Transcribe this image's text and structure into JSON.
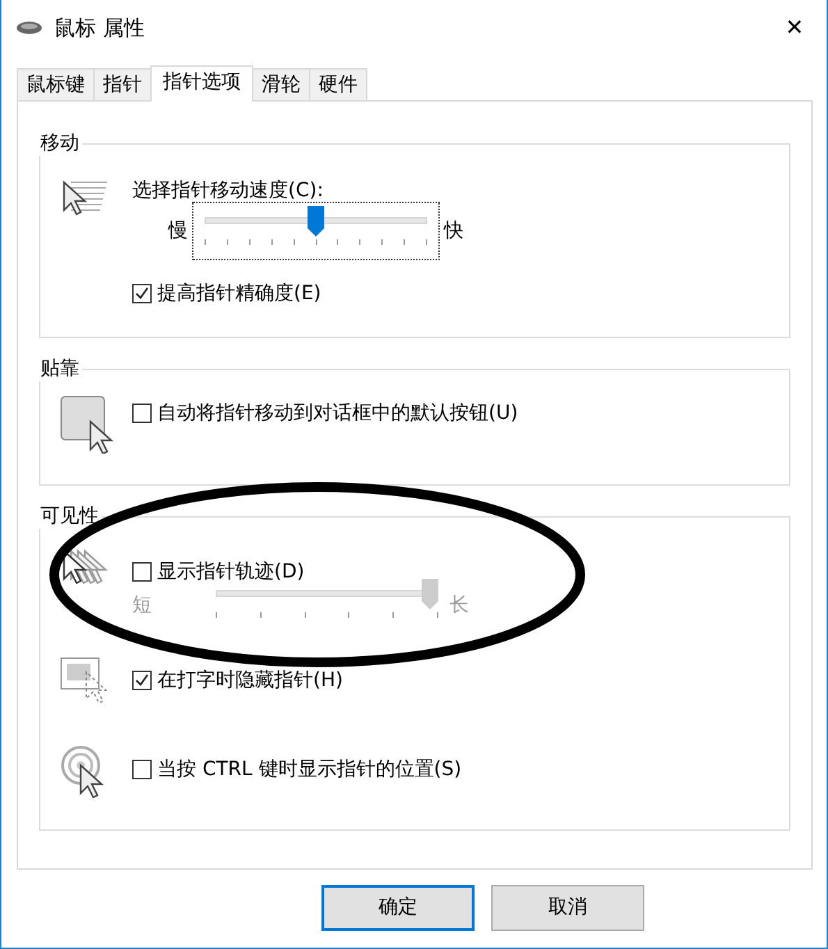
{
  "window": {
    "title": "鼠标 属性",
    "close": "✕"
  },
  "tabs": [
    {
      "label": "鼠标键",
      "selected": false
    },
    {
      "label": "指针",
      "selected": false
    },
    {
      "label": "指针选项",
      "selected": true
    },
    {
      "label": "滑轮",
      "selected": false
    },
    {
      "label": "硬件",
      "selected": false
    }
  ],
  "groups": [
    {
      "title": "移动",
      "sections": [
        {
          "kind": "speed",
          "items": [
            {
              "kind": "label",
              "text": "选择指针移动速度(C):"
            },
            {
              "kind": "slider",
              "min_label": "慢",
              "max_label": "快",
              "level": 0.5,
              "disabled": false,
              "focused": true
            },
            {
              "kind": "checkbox",
              "label": "提高指针精确度(E)",
              "checked": true
            }
          ]
        }
      ]
    },
    {
      "title": "贴靠",
      "sections": [
        {
          "kind": "snap",
          "items": [
            {
              "kind": "checkbox",
              "label": "自动将指针移动到对话框中的默认按钮(U)",
              "checked": false
            }
          ]
        }
      ]
    },
    {
      "title": "可见性",
      "sections": [
        {
          "kind": "trails",
          "items": [
            {
              "kind": "checkbox",
              "label": "显示指针轨迹(D)",
              "checked": false
            },
            {
              "kind": "slider",
              "min_label": "短",
              "max_label": "长",
              "level": 1.0,
              "disabled": true,
              "focused": false
            }
          ]
        },
        {
          "kind": "hide",
          "items": [
            {
              "kind": "checkbox",
              "label": "在打字时隐藏指针(H)",
              "checked": true
            }
          ]
        },
        {
          "kind": "locate",
          "items": [
            {
              "kind": "checkbox",
              "label": "当按 CTRL 键时显示指针的位置(S)",
              "checked": false
            }
          ]
        }
      ]
    }
  ],
  "buttons": [
    {
      "label": "确定",
      "default": true
    },
    {
      "label": "取消",
      "default": false
    }
  ],
  "annotation": {
    "kind": "ellipse"
  }
}
